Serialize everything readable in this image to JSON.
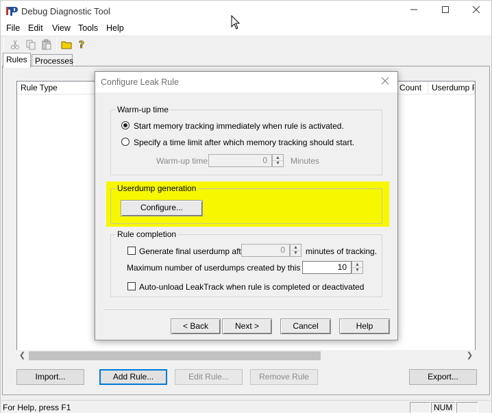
{
  "window": {
    "title": "Debug Diagnostic Tool"
  },
  "menu": [
    "File",
    "Edit",
    "View",
    "Tools",
    "Help"
  ],
  "toolbar": {
    "icons": [
      "cut-icon",
      "copy-icon",
      "paste-icon",
      "open-folder-icon",
      "help-icon"
    ]
  },
  "tabs": [
    {
      "label": "Rules",
      "active": true
    },
    {
      "label": "Processes",
      "active": false
    }
  ],
  "list": {
    "columns": [
      "Rule Type",
      "Count",
      "Userdump Pa"
    ]
  },
  "buttons": {
    "import": "Import...",
    "add_rule": "Add Rule...",
    "edit_rule": "Edit Rule...",
    "remove_rule": "Remove Rule",
    "export": "Export..."
  },
  "status": {
    "text": "For Help, press F1",
    "num": "NUM"
  },
  "dialog": {
    "title": "Configure Leak Rule",
    "warmup": {
      "group_label": "Warm-up time",
      "radio_immediate": "Start memory tracking immediately when rule is activated.",
      "radio_limit": "Specify a time limit after which memory tracking should start.",
      "time_label": "Warm-up time:",
      "time_value": "0",
      "time_unit": "Minutes"
    },
    "userdump": {
      "group_label": "Userdump generation",
      "configure": "Configure...",
      "highlight_color": "#f7f700"
    },
    "completion": {
      "group_label": "Rule completion",
      "generate_final": "Generate final userdump after",
      "final_value": "0",
      "final_suffix": "minutes of tracking.",
      "max_label": "Maximum number of userdumps created by this rule:",
      "max_value": "10",
      "auto_unload": "Auto-unload LeakTrack when rule is completed or deactivated"
    },
    "buttons": {
      "back": "< Back",
      "next": "Next >",
      "cancel": "Cancel",
      "help": "Help"
    }
  }
}
